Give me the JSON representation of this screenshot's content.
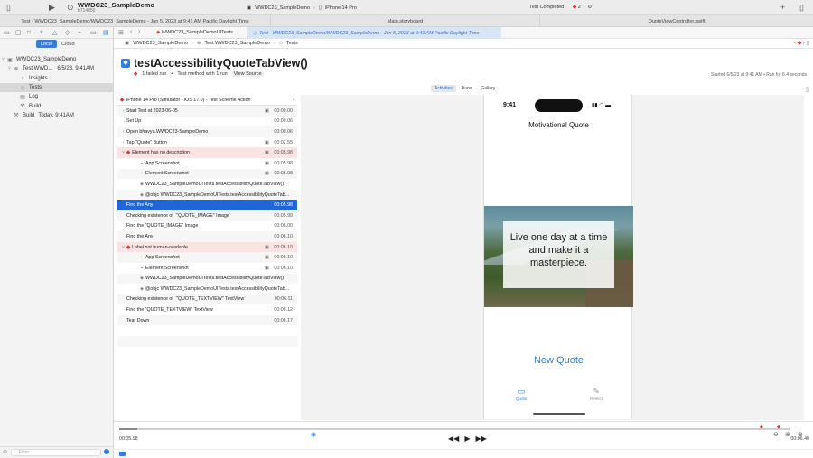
{
  "titlebar": {
    "project_name": "WWDC23_SampleDemo",
    "branch": "b714850",
    "scheme_target": "WWDC23_SampleDemo",
    "device": "iPhone 14 Pro",
    "status": "Test Completed",
    "error_count": "2"
  },
  "tabs": [
    {
      "label": "Test - WWDC23_SampleDemo/WWDC23_SampleDemo - Jun 5, 2023 at 9:41 AM Pacific Daylight Time"
    },
    {
      "label": "Main.storyboard"
    },
    {
      "label": "QuoteViewController.swift"
    }
  ],
  "second_tabs": {
    "file": "WWDC23_SampleDemoUITests",
    "active": "Test - WWDC23_SampleDemo/WWDC23_SampleDemo - Jun 5, 2023 at 9:41 AM Pacific Daylight Time"
  },
  "navigator": {
    "seg_local": "Local",
    "seg_cloud": "Cloud",
    "filter_placeholder": "Filter",
    "items": [
      {
        "label": "WWDC23_SampleDemo",
        "icon": "project-icon"
      },
      {
        "label": "Test WWD...",
        "detail": "6/5/23, 9:41AM",
        "icon": "test-icon"
      },
      {
        "label": "Insights",
        "icon": "lightbulb-icon"
      },
      {
        "label": "Tests",
        "icon": "diamond-icon"
      },
      {
        "label": "Log",
        "icon": "doc-icon"
      },
      {
        "label": "Build",
        "icon": "hammer-icon"
      },
      {
        "label": "Build",
        "detail": "Today, 9:41AM",
        "icon": "hammer-icon"
      }
    ]
  },
  "jumpbar": {
    "crumbs": [
      "WWDC23_SampleDemo",
      "Test WWDC23_SampleDemo",
      "Tests"
    ]
  },
  "test": {
    "title": "testAccessibilityQuoteTabView()",
    "failed": "1 failed run",
    "method": "Test method with 1 run",
    "view_source": "View Source",
    "started": "Started 6/5/23 at 9:41 AM • Ran for 6.4 seconds"
  },
  "subtabs": [
    "Activities",
    "Runs",
    "Gallery"
  ],
  "log": {
    "header": "iPhone 14 Pro (Simulator - iOS 17.0) - Test Scheme Action",
    "rows": [
      {
        "label": "Start Test at 2023-06-05",
        "time": "00:00.00",
        "indent": 0,
        "chev": true,
        "cam": true
      },
      {
        "label": "Set Up",
        "time": "00:00.06",
        "indent": 0
      },
      {
        "label": "Open bhavya.WWDC23-SampleDemo",
        "time": "00:00.06",
        "indent": 0,
        "chev": true
      },
      {
        "label": "Tap \"Quote\" Button",
        "time": "00:02.55",
        "indent": 0,
        "chev": true,
        "cam": true
      },
      {
        "label": "Element has no description",
        "time": "00:05.98",
        "indent": 0,
        "chev": true,
        "err": true,
        "cam": true
      },
      {
        "label": "App Screenshot",
        "time": "00:05.98",
        "indent": 1,
        "cam": true
      },
      {
        "label": "Element Screenshot",
        "time": "00:05.98",
        "indent": 1,
        "cam": true
      },
      {
        "label": "WWDC23_SampleDemoUITests.testAccessibilityQuoteTabView()",
        "time": "",
        "indent": 1
      },
      {
        "label": "@objc WWDC23_SampleDemoUITests.testAccessibilityQuoteTab...",
        "time": "",
        "indent": 1
      },
      {
        "label": "Find the Any",
        "time": "00:05.98",
        "indent": 0,
        "sel": true
      },
      {
        "label": "Checking existence of `\"QUOTE_IMAGE\" Image`",
        "time": "00:05.99",
        "indent": 0
      },
      {
        "label": "Find the \"QUOTE_IMAGE\" Image",
        "time": "00:06.00",
        "indent": 0
      },
      {
        "label": "Find the Any",
        "time": "00:06.10",
        "indent": 0
      },
      {
        "label": "Label not human-readable",
        "time": "00:06.10",
        "indent": 0,
        "chev": true,
        "err": true,
        "cam": true
      },
      {
        "label": "App Screenshot",
        "time": "00:06.10",
        "indent": 1,
        "cam": true
      },
      {
        "label": "Element Screenshot",
        "time": "00:06.10",
        "indent": 1,
        "cam": true
      },
      {
        "label": "WWDC23_SampleDemoUITests.testAccessibilityQuoteTabView()",
        "time": "",
        "indent": 1
      },
      {
        "label": "@objc WWDC23_SampleDemoUITests.testAccessibilityQuoteTab...",
        "time": "",
        "indent": 1
      },
      {
        "label": "Checking existence of `\"QUOTE_TEXTVIEW\" TextView`",
        "time": "00:06.11",
        "indent": 0
      },
      {
        "label": "Find the \"QUOTE_TEXTVIEW\" TextView",
        "time": "00:06.12",
        "indent": 0
      },
      {
        "label": "Tear Down",
        "time": "00:06.17",
        "indent": 0
      }
    ]
  },
  "phone": {
    "time": "9:41",
    "title": "Motivational Quote",
    "quote": "Live one day at a time and make it a masterpiece.",
    "button": "New Quote",
    "tab_quote": "Quote",
    "tab_reflect": "Reflect"
  },
  "timeline": {
    "current": "00:05.98",
    "total": "00:06.40"
  }
}
